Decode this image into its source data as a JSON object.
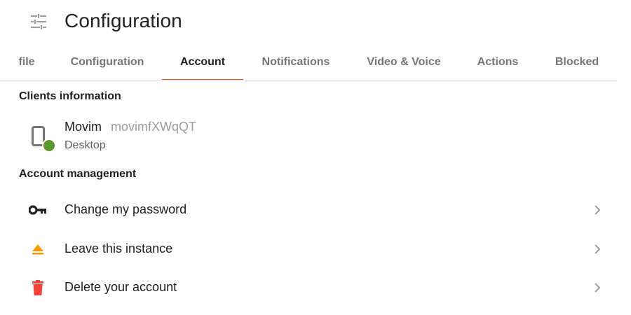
{
  "header": {
    "title": "Configuration",
    "icon": "tune-icon"
  },
  "tabs": [
    {
      "label": "file",
      "active": false
    },
    {
      "label": "Configuration",
      "active": false
    },
    {
      "label": "Account",
      "active": true
    },
    {
      "label": "Notifications",
      "active": false
    },
    {
      "label": "Video & Voice",
      "active": false
    },
    {
      "label": "Actions",
      "active": false
    },
    {
      "label": "Blocked",
      "active": false
    }
  ],
  "clients": {
    "title": "Clients information",
    "items": [
      {
        "name": "Movim",
        "id": "movimfXWqQT",
        "type": "Desktop",
        "icon": "phone-icon",
        "status_color": "#5b9a2f"
      }
    ]
  },
  "account": {
    "title": "Account management",
    "items": [
      {
        "label": "Change my password",
        "icon": "key-icon",
        "color": "#212121"
      },
      {
        "label": "Leave this instance",
        "icon": "eject-icon",
        "color": "#ff9800"
      },
      {
        "label": "Delete your account",
        "icon": "trash-icon",
        "color": "#f44336"
      }
    ]
  },
  "colors": {
    "accent": "#f4511e",
    "muted": "#757575"
  }
}
